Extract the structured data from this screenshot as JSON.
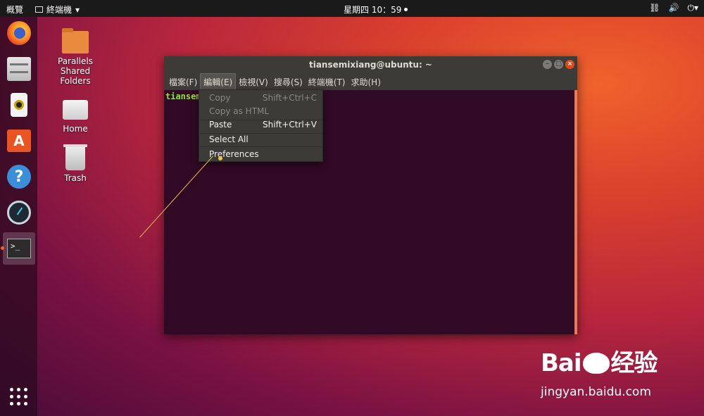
{
  "topbar": {
    "activities_label": "概覽",
    "app_menu_label": "終端機",
    "clock": "星期四 10：59"
  },
  "dock": {
    "items": [
      "firefox-icon",
      "files-icon",
      "rhythmbox-icon",
      "software-icon",
      "help-icon",
      "gauge-icon",
      "terminal-icon"
    ],
    "apps_grid": "show-applications-icon"
  },
  "desktop": {
    "icons": [
      {
        "label": "Parallels Shared Folders"
      },
      {
        "label": "Home"
      },
      {
        "label": "Trash"
      }
    ]
  },
  "terminal": {
    "title": "tiansemixiang@ubuntu: ~",
    "prompt_visible": "tiansem",
    "menu": [
      "檔案(F)",
      "編輯(E)",
      "檢視(V)",
      "搜尋(S)",
      "終端機(T)",
      "求助(H)"
    ],
    "open_menu": "編輯(E)"
  },
  "dropdown": {
    "items": [
      {
        "label": "Copy",
        "shortcut": "Shift+Ctrl+C",
        "enabled": false
      },
      {
        "label": "Copy as HTML",
        "shortcut": "",
        "enabled": false
      },
      {
        "label": "Paste",
        "shortcut": "Shift+Ctrl+V",
        "enabled": true
      },
      {
        "label": "Select All",
        "shortcut": "",
        "enabled": true
      },
      {
        "label": "Preferences",
        "shortcut": "",
        "enabled": true
      }
    ]
  },
  "watermark": {
    "logo_left": "Bai",
    "logo_right": "经验",
    "url": "jingyan.baidu.com"
  },
  "colors": {
    "terminal_bg": "#300a24",
    "prompt_green": "#8ae234",
    "accent_orange": "#e95420"
  }
}
